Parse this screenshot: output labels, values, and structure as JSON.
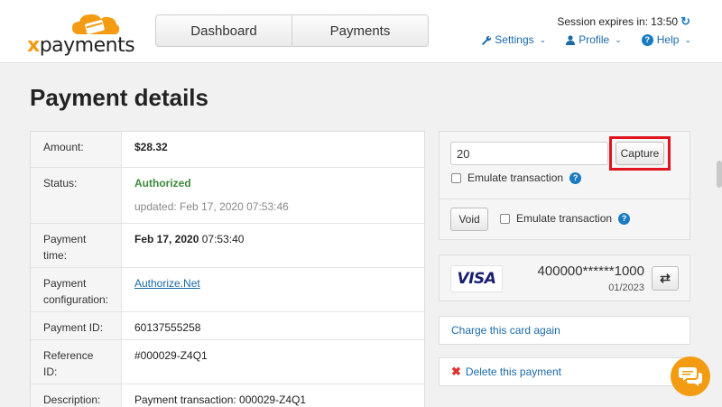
{
  "header": {
    "logo_text_x": "x",
    "logo_text_rest": "payments",
    "nav": [
      "Dashboard",
      "Payments"
    ],
    "session_label": "Session expires in:",
    "session_time": "13:50",
    "menus": [
      "Settings",
      "Profile",
      "Help"
    ]
  },
  "page_title": "Payment details",
  "details": {
    "amount_label": "Amount:",
    "amount_value": "$28.32",
    "status_label": "Status:",
    "status_value": "Authorized",
    "status_updated": "updated: Feb 17, 2020 07:53:46",
    "time_label": "Payment time:",
    "time_date": "Feb 17, 2020",
    "time_clock": " 07:53:40",
    "config_label": "Payment configuration:",
    "config_value": "Authorize.Net",
    "id_label": "Payment ID:",
    "id_value": "60137555258",
    "ref_label": "Reference ID:",
    "ref_value": "#000029-Z4Q1",
    "desc_label": "Description:",
    "desc_value": "Payment transaction: 000029-Z4Q1"
  },
  "capture": {
    "amount_value": "20",
    "capture_label": "Capture",
    "emulate_label": "Emulate transaction",
    "void_label": "Void"
  },
  "card": {
    "brand": "VISA",
    "pan": "400000******1000",
    "expiry": "01/2023"
  },
  "actions": {
    "charge_again": "Charge this card again",
    "delete": "Delete this payment"
  },
  "colors": {
    "accent": "#1a6aa8",
    "brand_orange": "#f39c12",
    "status_ok": "#3c8a3c",
    "highlight": "#e0141e"
  }
}
